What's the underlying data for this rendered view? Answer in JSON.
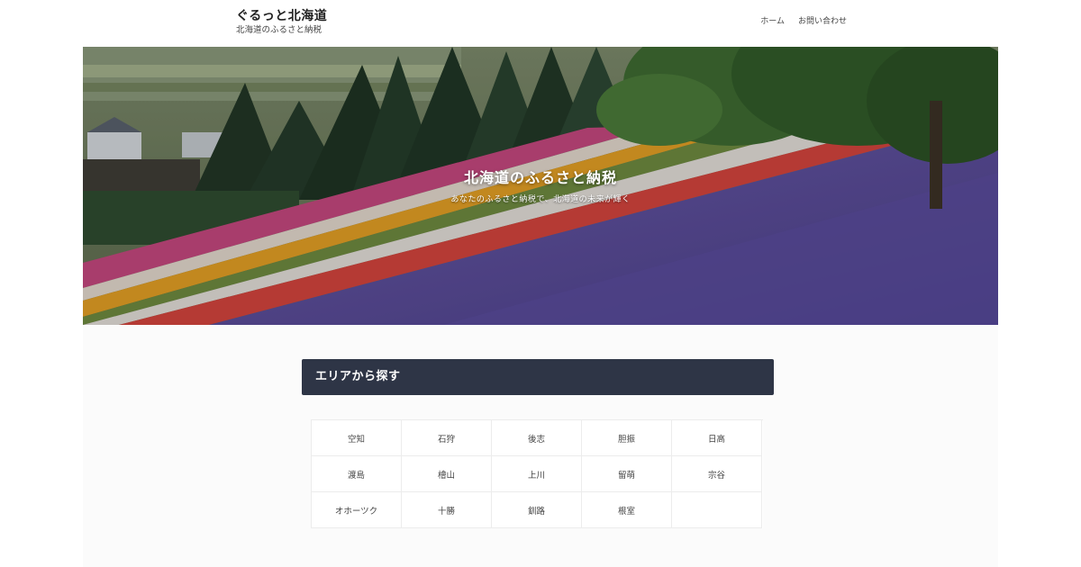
{
  "header": {
    "site_title": "ぐるっと北海道",
    "tagline": "北海道のふるさと納税",
    "nav": [
      "ホーム",
      "お問い合わせ"
    ]
  },
  "hero": {
    "title": "北海道のふるさと納税",
    "subtitle": "あなたのふるさと納税で、北海道の未来が輝く"
  },
  "area_section": {
    "heading": "エリアから探す",
    "areas": [
      "空知",
      "石狩",
      "後志",
      "胆振",
      "日高",
      "渡島",
      "檜山",
      "上川",
      "留萌",
      "宗谷",
      "オホーツク",
      "十勝",
      "釧路",
      "根室",
      ""
    ]
  },
  "colors": {
    "heading_bg": "#2e3546",
    "lavender": "#5b4a9e",
    "pink": "#c8457e",
    "yellow": "#e8a020"
  }
}
